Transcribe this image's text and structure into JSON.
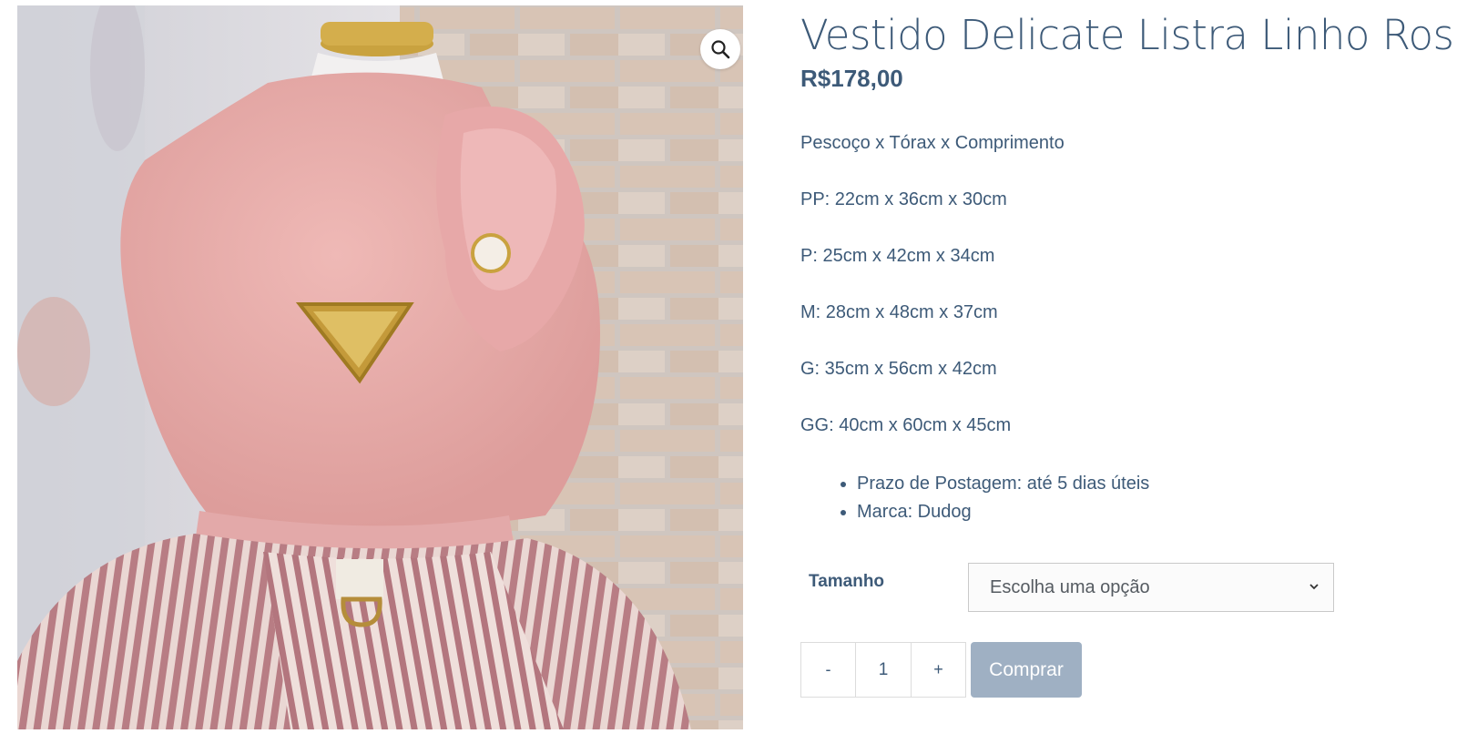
{
  "product": {
    "title": "Vestido Delicate Listra Linho Rose",
    "price": "R$178,00",
    "image_alt": "Vestido rosa com saia listrada em manequim"
  },
  "description": {
    "paragraphs": [
      "Pescoço x Tórax x Comprimento",
      "PP: 22cm x 36cm x 30cm",
      "P: 25cm x 42cm x 34cm",
      "M: 28cm x 48cm x 37cm",
      "G: 35cm x 56cm x 42cm",
      "GG: 40cm x 60cm x 45cm"
    ],
    "bullets": [
      "Prazo de Postagem: até 5 dias úteis",
      "Marca: Dudog"
    ]
  },
  "variations": {
    "label": "Tamanho",
    "selected": "Escolha uma opção"
  },
  "cart": {
    "minus": "-",
    "quantity": "1",
    "plus": "+",
    "buy_label": "Comprar"
  },
  "icons": {
    "zoom": "magnifier-icon",
    "select": "chevron-down-icon"
  },
  "colors": {
    "text": "#3d5a78",
    "button": "#9fb0c3"
  }
}
